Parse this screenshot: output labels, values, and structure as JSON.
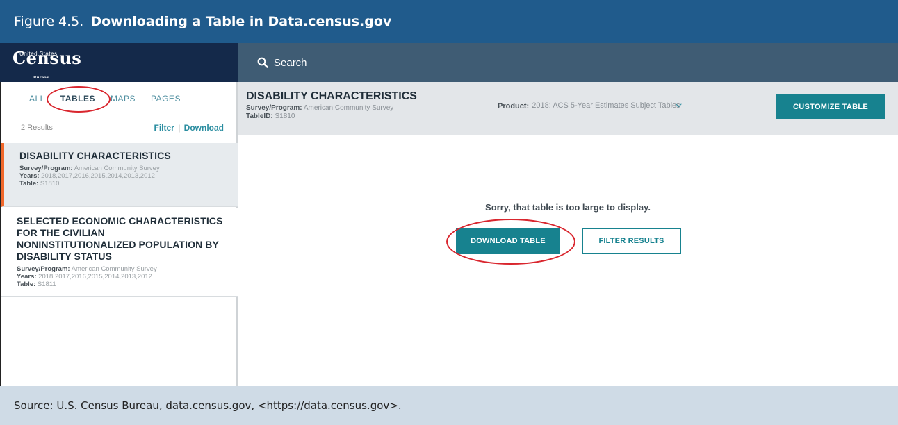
{
  "figure": {
    "number": "Figure 4.5.",
    "title": "Downloading a Table in Data.census.gov",
    "source": "Source: U.S. Census Bureau, data.census.gov, <https://data.census.gov>."
  },
  "logo": {
    "text": "Census",
    "top_text": "United States",
    "bottom_text": "Bureau"
  },
  "search": {
    "label": "Search"
  },
  "sidebar": {
    "tabs": [
      {
        "label": "ALL"
      },
      {
        "label": "TABLES"
      },
      {
        "label": "MAPS"
      },
      {
        "label": "PAGES"
      }
    ],
    "results_count": "2 Results",
    "filter_label": "Filter",
    "separator": "|",
    "download_label": "Download",
    "cards": [
      {
        "title": "DISABILITY CHARACTERISTICS",
        "survey_label": "Survey/Program:",
        "survey": "American Community Survey",
        "years_label": "Years:",
        "years": "2018,2017,2016,2015,2014,2013,2012",
        "table_label": "Table:",
        "table": "S1810"
      },
      {
        "title": "SELECTED ECONOMIC CHARACTERISTICS FOR THE CIVILIAN NONINSTITUTIONALIZED POPULATION BY DISABILITY STATUS",
        "survey_label": "Survey/Program:",
        "survey": "American Community Survey",
        "years_label": "Years:",
        "years": "2018,2017,2016,2015,2014,2013,2012",
        "table_label": "Table:",
        "table": "S1811"
      }
    ]
  },
  "main": {
    "title": "DISABILITY CHARACTERISTICS",
    "survey_label": "Survey/Program:",
    "survey": "American Community Survey",
    "tableid_label": "TableID:",
    "tableid": "S1810",
    "product_label": "Product:",
    "product_value": "2018: ACS 5-Year Estimates Subject Tables",
    "customize_label": "CUSTOMIZE TABLE",
    "message": "Sorry, that table is too large to display.",
    "download_table_label": "DOWNLOAD TABLE",
    "filter_results_label": "FILTER RESULTS"
  },
  "colors": {
    "header_bg": "#205b8c",
    "nav_dark": "#14294a",
    "search_bg": "#3f5c74",
    "accent_teal": "#17828f",
    "highlight_red": "#d9262e",
    "active_bar": "#f1682b",
    "source_bg": "#cfdbe6"
  }
}
